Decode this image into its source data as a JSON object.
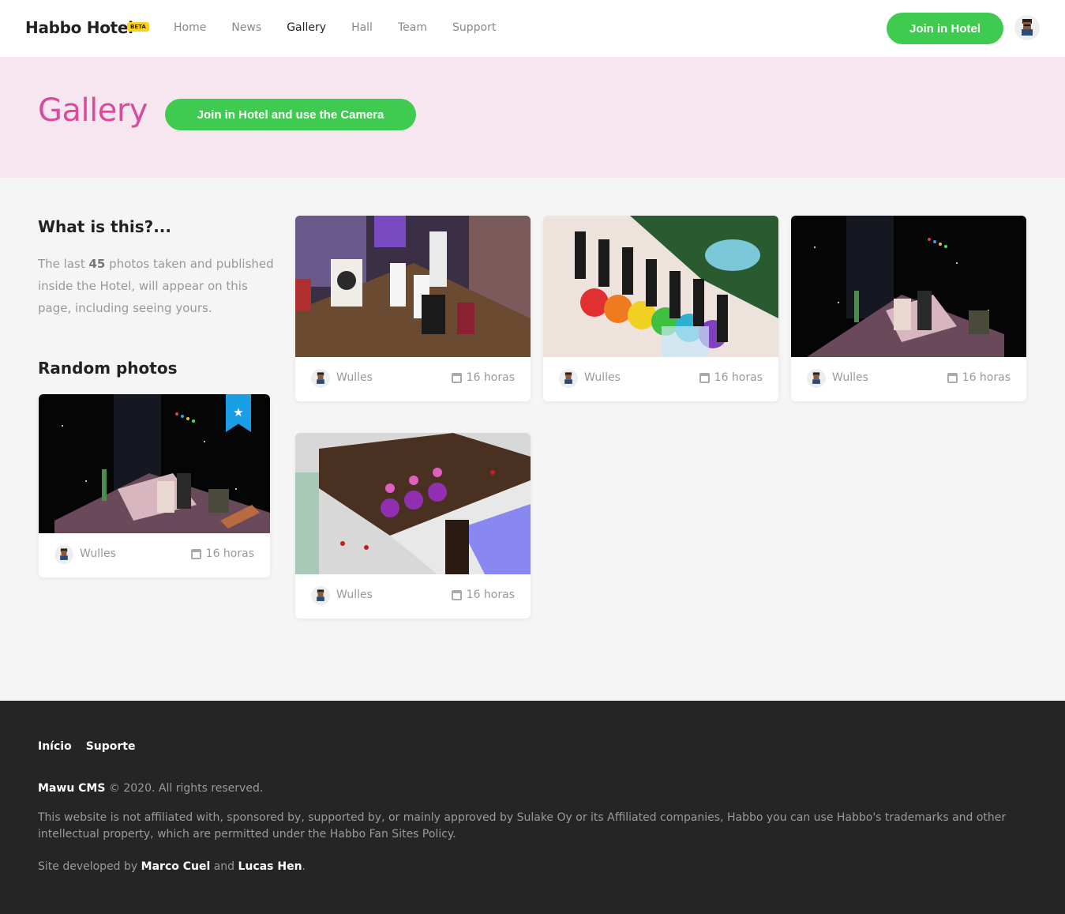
{
  "header": {
    "logo": "Habbo Hotel",
    "badge": "BETA",
    "nav": [
      "Home",
      "News",
      "Gallery",
      "Hall",
      "Team",
      "Support"
    ],
    "active_nav": "Gallery",
    "join_button": "Join in Hotel",
    "accent_color": "#3ecb4f"
  },
  "hero": {
    "title": "Gallery",
    "title_color": "#d94c9a",
    "button": "Join in Hotel and use the Camera"
  },
  "sidebar": {
    "title": "What is this?...",
    "text_before": "The last ",
    "count": "45",
    "text_after": " photos taken and published inside the Hotel, will appear on this page, including seeing yours.",
    "random_title": "Random photos",
    "random_photo": {
      "user": "Wulles",
      "time": "16 horas",
      "scene": "space"
    }
  },
  "gallery": [
    {
      "user": "Wulles",
      "time": "16 horas",
      "scene": "castle"
    },
    {
      "user": "Wulles",
      "time": "16 horas",
      "scene": "rainbow"
    },
    {
      "user": "Wulles",
      "time": "16 horas",
      "scene": "space"
    },
    {
      "user": "Wulles",
      "time": "16 horas",
      "scene": "pool"
    }
  ],
  "footer": {
    "links": [
      "Início",
      "Suporte"
    ],
    "brand": "Mawu CMS",
    "copyright": " © 2020. All rights reserved.",
    "disclaimer": "This website is not affiliated with, sponsored by, supported by, or mainly approved by Sulake Oy or its Affiliated companies, Habbo you can use Habbo's trademarks and other intellectual property, which are permitted under the Habbo Fan Sites Policy.",
    "dev_prefix": "Site developed by ",
    "dev1": "Marco Cuel",
    "dev_and": " and ",
    "dev2": "Lucas Hen",
    "dev_suffix": "."
  }
}
